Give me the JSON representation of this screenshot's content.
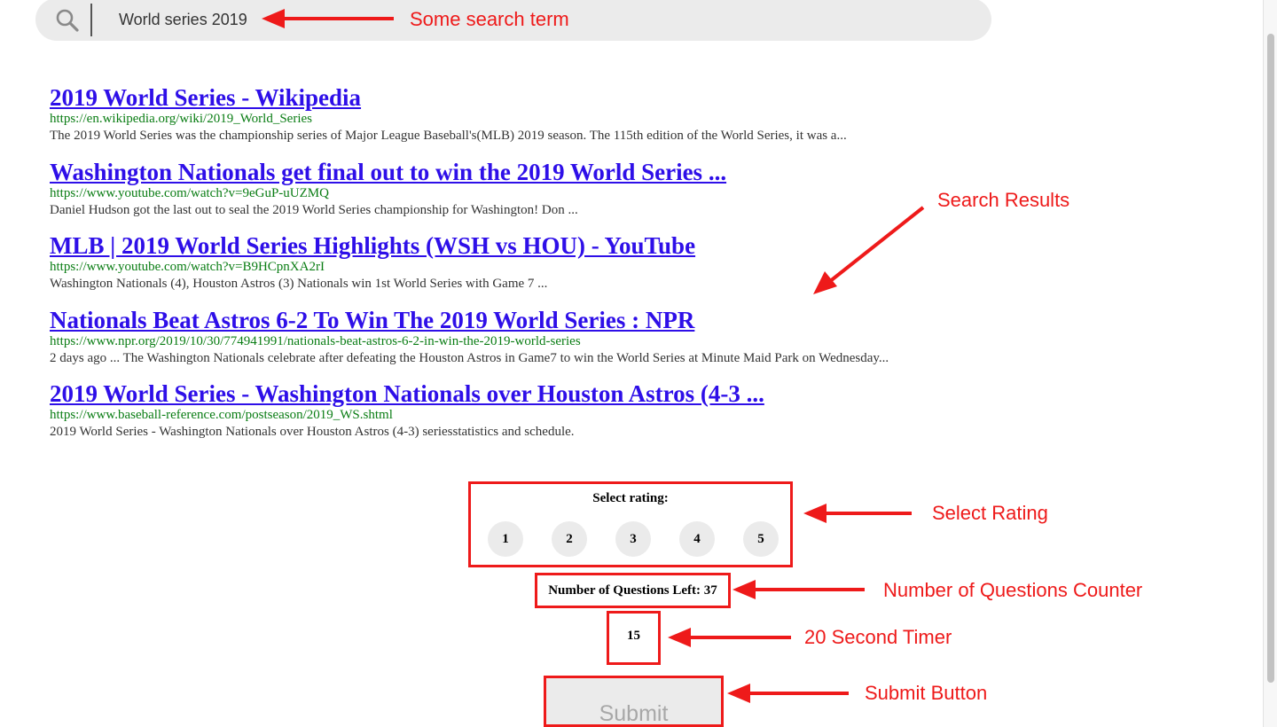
{
  "search": {
    "query": "World series 2019",
    "icon": "search-icon"
  },
  "results": [
    {
      "title": "2019 World Series - Wikipedia",
      "url": "https://en.wikipedia.org/wiki/2019_World_Series",
      "snippet": "The 2019 World Series was the championship series of Major League Baseball's(MLB) 2019 season. The 115th edition of the World Series, it was a..."
    },
    {
      "title": "Washington Nationals get final out to win the 2019 World Series ...",
      "url": "https://www.youtube.com/watch?v=9eGuP-uUZMQ",
      "snippet": "Daniel Hudson got the last out to seal the 2019 World Series championship for Washington! Don ..."
    },
    {
      "title": "MLB | 2019 World Series Highlights (WSH vs HOU) - YouTube",
      "url": "https://www.youtube.com/watch?v=B9HCpnXA2rI",
      "snippet": "Washington Nationals (4), Houston Astros (3) Nationals win 1st World Series with Game 7 ..."
    },
    {
      "title": "Nationals Beat Astros 6-2 To Win The 2019 World Series : NPR",
      "url": "https://www.npr.org/2019/10/30/774941991/nationals-beat-astros-6-2-in-win-the-2019-world-series",
      "snippet": "2 days ago ... The Washington Nationals celebrate after defeating the Houston Astros in Game7 to win the World Series at Minute Maid Park on Wednesday..."
    },
    {
      "title": "2019 World Series - Washington Nationals over Houston Astros (4-3 ...",
      "url": "https://www.baseball-reference.com/postseason/2019_WS.shtml",
      "snippet": "2019 World Series - Washington Nationals over Houston Astros (4-3) seriesstatistics and schedule."
    }
  ],
  "rating": {
    "label": "Select rating:",
    "options": [
      "1",
      "2",
      "3",
      "4",
      "5"
    ]
  },
  "counter": {
    "text": "Number of Questions Left: 37"
  },
  "timer": {
    "value": "15"
  },
  "submit": {
    "label": "Submit"
  },
  "annotations": {
    "search_term": "Some search term",
    "search_results": "Search Results",
    "select_rating": "Select Rating",
    "questions_counter": "Number of Questions Counter",
    "timer": "20 Second Timer",
    "submit_button": "Submit Button"
  },
  "colors": {
    "annotation": "#ee1a1a",
    "link": "#2e0fe8",
    "url": "#0a7d14",
    "snippet": "#333333",
    "control_bg": "#ebebeb"
  }
}
